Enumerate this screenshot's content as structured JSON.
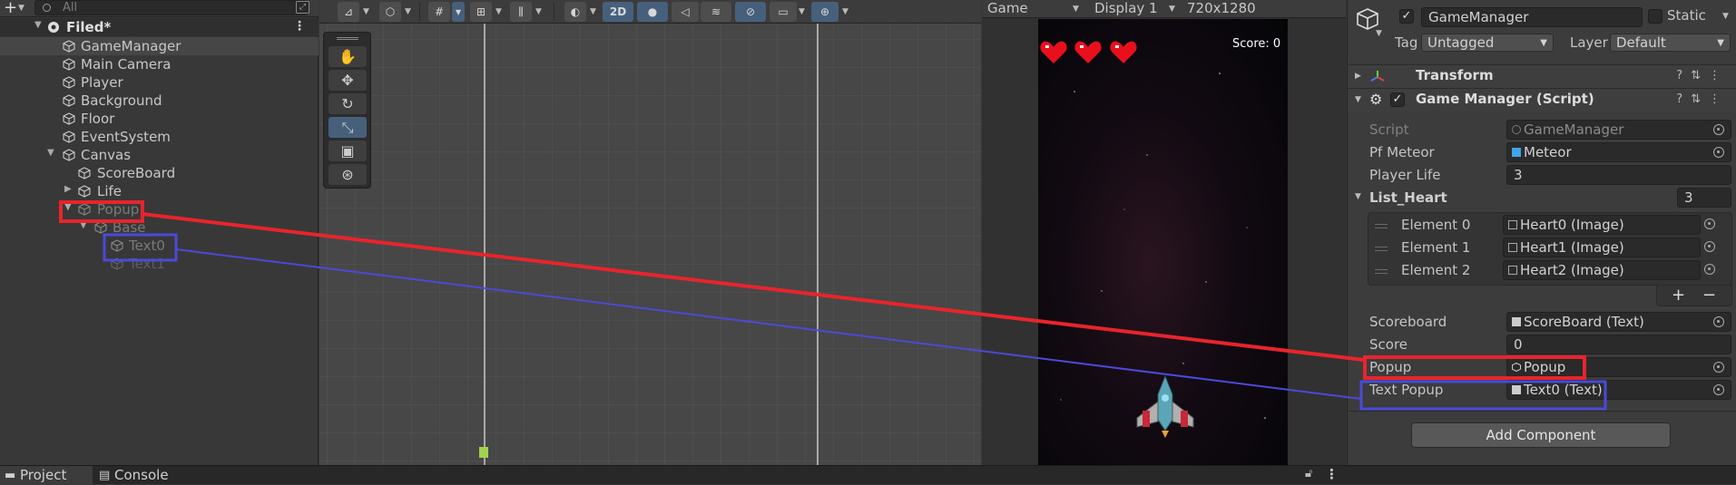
{
  "hierarchy": {
    "search_placeholder": "All",
    "scene_name": "Filed*",
    "items": [
      {
        "label": "GameManager"
      },
      {
        "label": "Main Camera"
      },
      {
        "label": "Player"
      },
      {
        "label": "Background"
      },
      {
        "label": "Floor"
      },
      {
        "label": "EventSystem"
      },
      {
        "label": "Canvas"
      },
      {
        "label": "ScoreBoard"
      },
      {
        "label": "Life"
      },
      {
        "label": "Popup"
      },
      {
        "label": "Base"
      },
      {
        "label": "Text0"
      },
      {
        "label": "Text1"
      }
    ]
  },
  "scene_toolbar": {
    "mode_2d": "2D"
  },
  "game_view": {
    "tab_label": "Game",
    "display": "Display 1",
    "resolution": "720x1280",
    "score_text": "Score: 0",
    "hearts": 3
  },
  "inspector": {
    "object_name": "GameManager",
    "static_label": "Static",
    "tag_label": "Tag",
    "tag_value": "Untagged",
    "layer_label": "Layer",
    "layer_value": "Default",
    "transform_title": "Transform",
    "script_component_title": "Game Manager (Script)",
    "script_label": "Script",
    "script_value": "GameManager",
    "pf_meteor_label": "Pf Meteor",
    "pf_meteor_value": "Meteor",
    "player_life_label": "Player Life",
    "player_life_value": "3",
    "list_heart_label": "List_Heart",
    "list_heart_count": "3",
    "elements": [
      {
        "label": "Element 0",
        "value": "Heart0 (Image)"
      },
      {
        "label": "Element 1",
        "value": "Heart1 (Image)"
      },
      {
        "label": "Element 2",
        "value": "Heart2 (Image)"
      }
    ],
    "add_symbol": "+",
    "remove_symbol": "−",
    "scoreboard_label": "Scoreboard",
    "scoreboard_value": "ScoreBoard (Text)",
    "score_label": "Score",
    "score_value": "0",
    "popup_label": "Popup",
    "popup_value": "Popup",
    "text_popup_label": "Text Popup",
    "text_popup_value": "Text0 (Text)",
    "add_component": "Add Component"
  },
  "bottom_tabs": [
    {
      "label": "Project"
    },
    {
      "label": "Console"
    }
  ],
  "colors": {
    "annotation_red": "#e8242c",
    "annotation_blue": "#4a4ad8",
    "selection": "#46607c",
    "gizmo": "#a0d24c"
  }
}
